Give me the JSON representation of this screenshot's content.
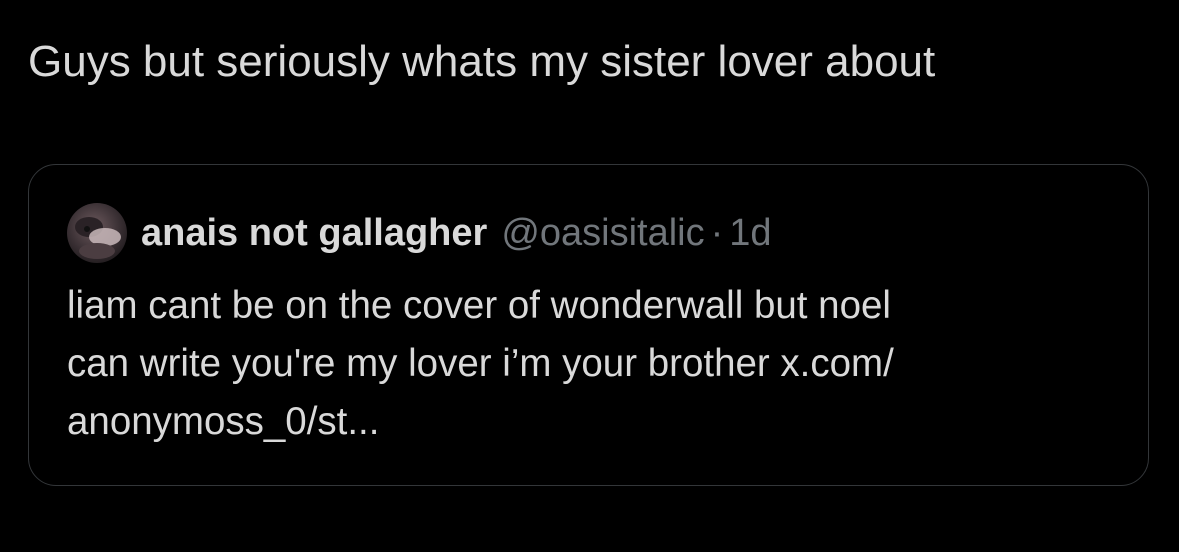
{
  "post": {
    "text": "Guys but seriously whats my sister lover about"
  },
  "quoted_post": {
    "author_name": "anais not gallagher",
    "author_handle": "@oasisitalic",
    "separator": "·",
    "timestamp": "1d",
    "body_line1": "liam cant be on the cover of wonderwall but noel",
    "body_line2": "can write you're my lover i’m your brother x.com/",
    "body_line3": "anonymoss_0/st..."
  },
  "colors": {
    "background": "#000000",
    "primary_text": "#d9d9d9",
    "secondary_text": "#71767b",
    "card_border": "#333639"
  }
}
